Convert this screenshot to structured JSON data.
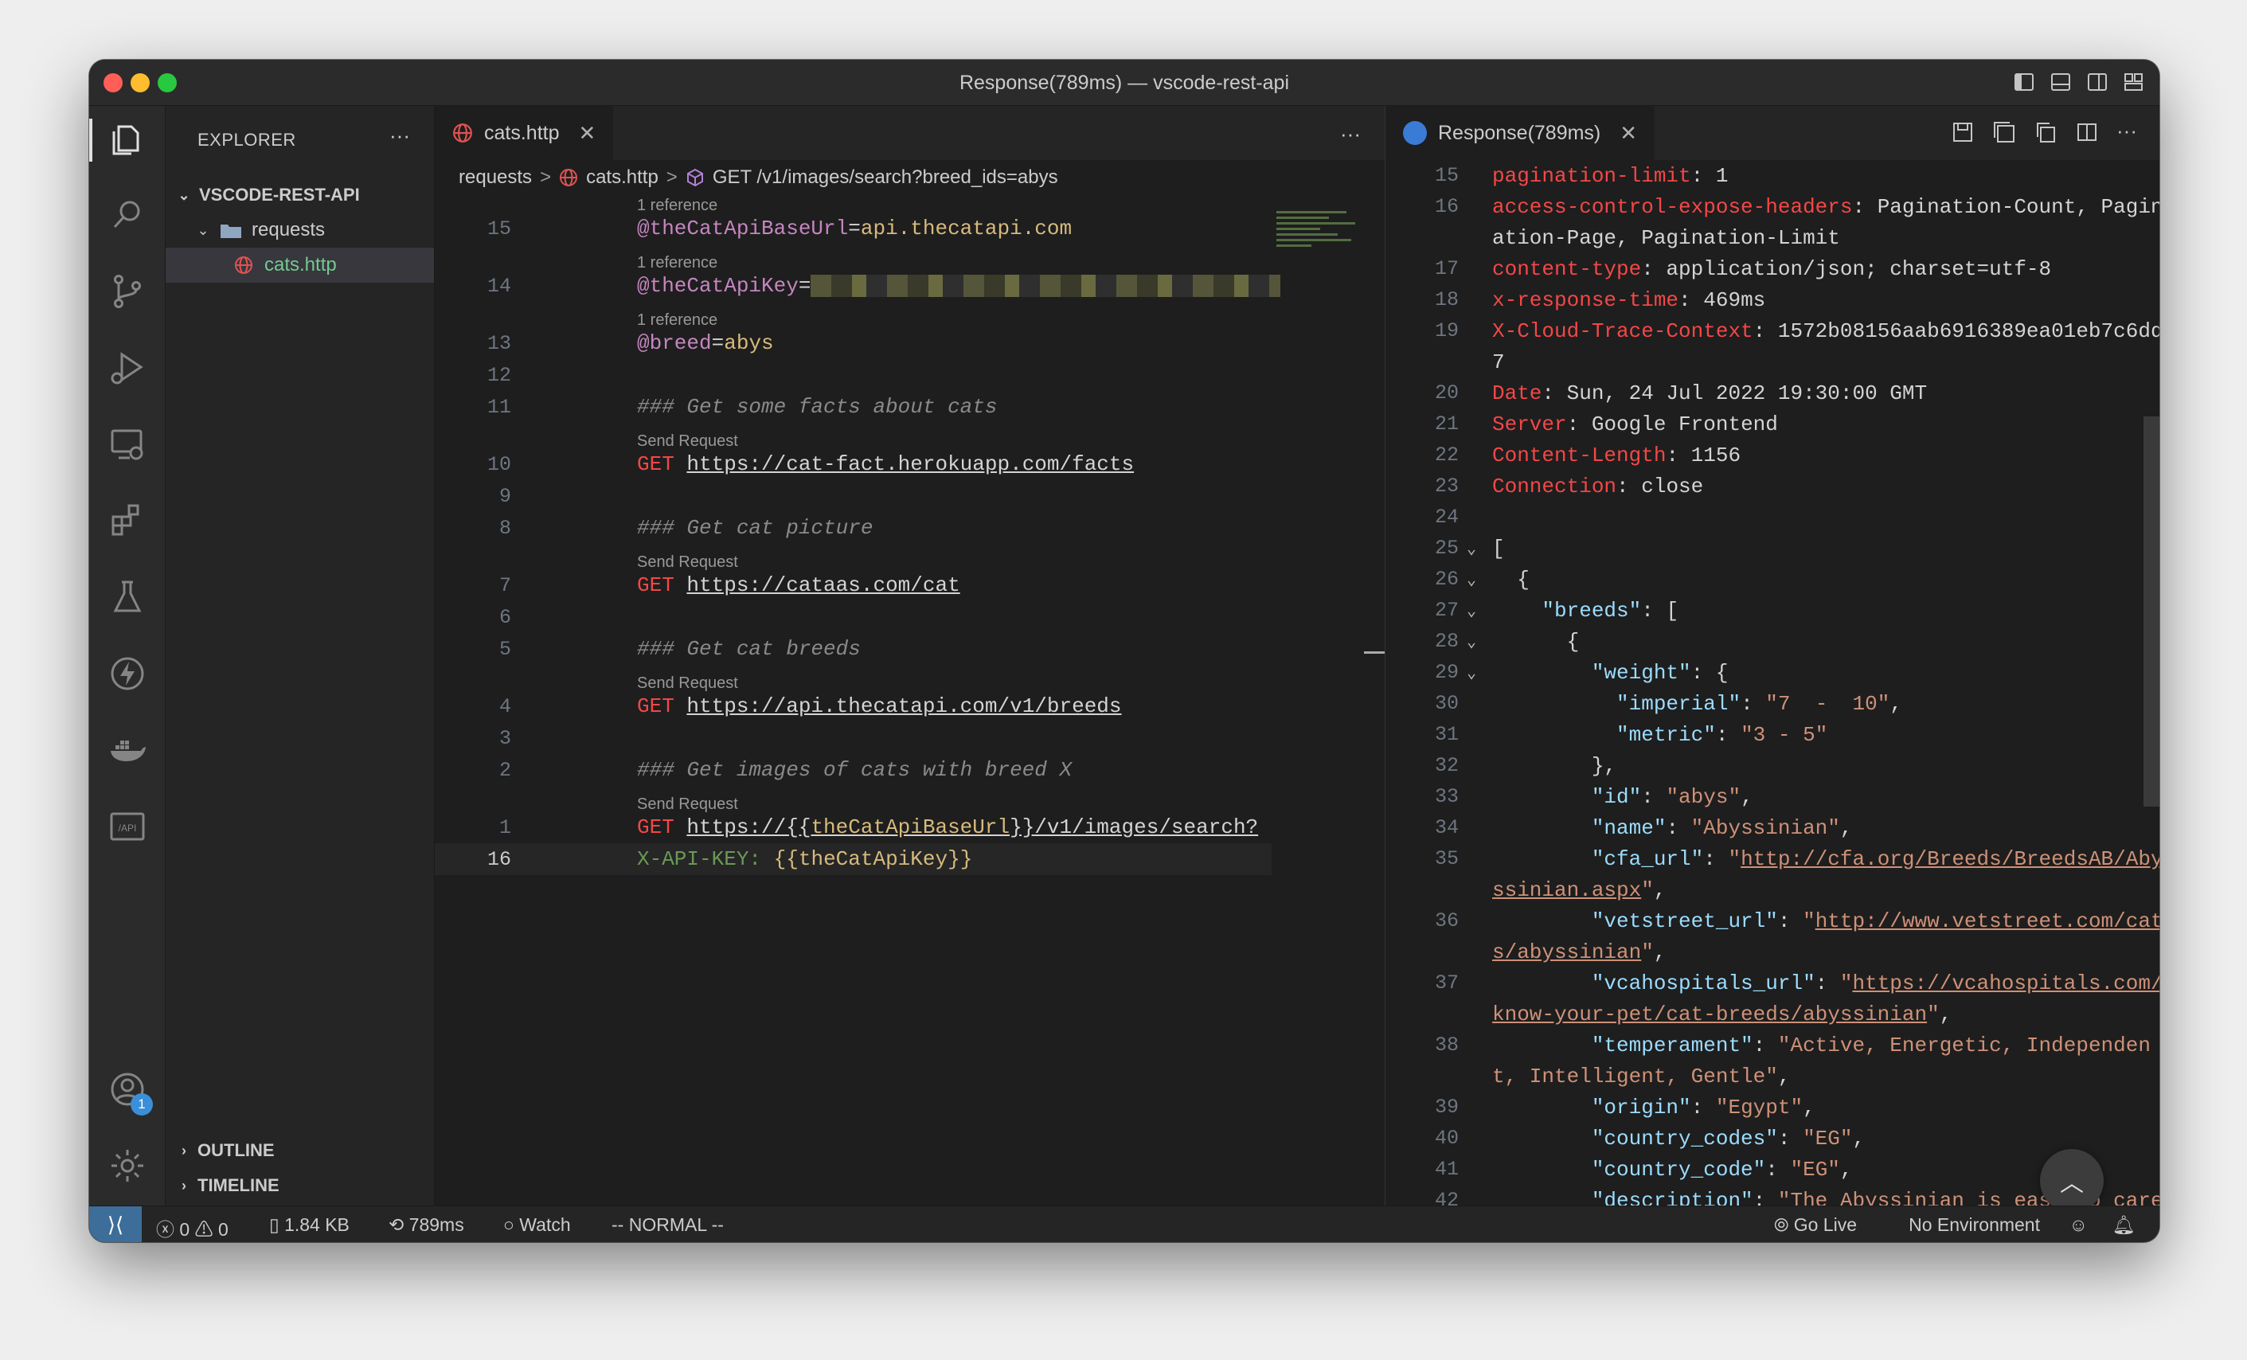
{
  "window": {
    "title": "Response(789ms) — vscode-rest-api"
  },
  "explorer": {
    "title": "EXPLORER",
    "more": "···",
    "project": "VSCODE-REST-API",
    "folder": "requests",
    "file": "cats.http",
    "outline": "OUTLINE",
    "timeline": "TIMELINE"
  },
  "activity": {
    "icons": [
      "files-icon",
      "search-icon",
      "source-control-icon",
      "run-debug-icon",
      "remote-explorer-icon",
      "extensions-icon",
      "testing-icon",
      "thunder-client-icon",
      "docker-icon",
      "api-icon",
      "accounts-icon",
      "settings-gear-icon"
    ],
    "accounts_badge": "1"
  },
  "left_editor": {
    "tab_label": "cats.http",
    "tab_close": "✕",
    "more": "···",
    "breadcrumb": {
      "folder": "requests",
      "file": "cats.http",
      "symbol": "GET /v1/images/search?breed_ids=abys",
      "sep": ">"
    },
    "lens_reference": "1 reference",
    "lens_send": "Send Request",
    "lines": {
      "l15": {
        "num": "15",
        "var": "@theCatApiBaseUrl",
        "eq": "=",
        "val": "api.thecatapi.com"
      },
      "l14": {
        "num": "14",
        "var": "@theCatApiKey",
        "eq": "="
      },
      "l13": {
        "num": "13",
        "var": "@breed",
        "eq": "=",
        "val": "abys"
      },
      "l12": {
        "num": "12"
      },
      "l11": {
        "num": "11",
        "comment": "### Get some facts about cats"
      },
      "l10": {
        "num": "10",
        "method": "GET",
        "url": "https://cat-fact.herokuapp.com/facts"
      },
      "l9": {
        "num": "9"
      },
      "l8": {
        "num": "8",
        "comment": "### Get cat picture"
      },
      "l7": {
        "num": "7",
        "method": "GET",
        "url": "https://cataas.com/cat"
      },
      "l6": {
        "num": "6"
      },
      "l5": {
        "num": "5",
        "comment": "### Get cat breeds"
      },
      "l4": {
        "num": "4",
        "method": "GET",
        "url": "https://api.thecatapi.com/v1/breeds"
      },
      "l3": {
        "num": "3"
      },
      "l2": {
        "num": "2",
        "comment": "### Get images of cats with breed X"
      },
      "l1": {
        "num": "1",
        "method": "GET",
        "url_a": "https://{{",
        "url_var": "theCatApiBaseUrl",
        "url_b": "}}/v1/images/search?"
      },
      "l16": {
        "num": "16",
        "header": "X-API-KEY:",
        "hval_a": "{{",
        "hval_var": "theCatApiKey",
        "hval_b": "}}"
      }
    }
  },
  "right_editor": {
    "tab_label": "Response(789ms)",
    "tab_close": "✕",
    "more": "···",
    "lines": [
      {
        "n": "15",
        "k": "pagination-limit",
        "v": " 1"
      },
      {
        "n": "16",
        "k": "access-control-expose-headers",
        "v": " Pagination-Count, Pagin"
      },
      {
        "n": "",
        "cont": "ation-Page, Pagination-Limit"
      },
      {
        "n": "17",
        "k": "content-type",
        "v": " application/json; charset=utf-8"
      },
      {
        "n": "18",
        "k": "x-response-time",
        "v": " 469ms"
      },
      {
        "n": "19",
        "k": "X-Cloud-Trace-Context",
        "v": " 1572b08156aab6916389ea01eb7c6dd"
      },
      {
        "n": "",
        "cont": "7"
      },
      {
        "n": "20",
        "k": "Date",
        "v": " Sun, 24 Jul 2022 19:30:00 GMT"
      },
      {
        "n": "21",
        "k": "Server",
        "v": " Google Frontend"
      },
      {
        "n": "22",
        "k": "Content-Length",
        "v": " 1156"
      },
      {
        "n": "23",
        "k": "Connection",
        "v": " close"
      },
      {
        "n": "24"
      },
      {
        "n": "25",
        "fold": true,
        "raw": "["
      },
      {
        "n": "26",
        "fold": true,
        "raw": "  {"
      },
      {
        "n": "27",
        "fold": true,
        "jk": "    \"breeds\"",
        "tail": ": ["
      },
      {
        "n": "28",
        "fold": true,
        "raw": "      {"
      },
      {
        "n": "29",
        "fold": true,
        "jk": "        \"weight\"",
        "tail": ": {"
      },
      {
        "n": "30",
        "jk": "          \"imperial\"",
        "tail": ": ",
        "js": "\"7  -  10\"",
        "end": ","
      },
      {
        "n": "31",
        "jk": "          \"metric\"",
        "tail": ": ",
        "js": "\"3 - 5\""
      },
      {
        "n": "32",
        "raw": "        },"
      },
      {
        "n": "33",
        "jk": "        \"id\"",
        "tail": ": ",
        "js": "\"abys\"",
        "end": ","
      },
      {
        "n": "34",
        "jk": "        \"name\"",
        "tail": ": ",
        "js": "\"Abyssinian\"",
        "end": ","
      },
      {
        "n": "35",
        "jk": "        \"cfa_url\"",
        "tail": ": ",
        "js": "\"",
        "jl": "http://cfa.org/Breeds/BreedsAB/Aby"
      },
      {
        "n": "",
        "jl": "ssinian.aspx",
        "js": "\"",
        "end": ","
      },
      {
        "n": "36",
        "jk": "        \"vetstreet_url\"",
        "tail": ": ",
        "js": "\"",
        "jl": "http://www.vetstreet.com/cat"
      },
      {
        "n": "",
        "jl": "s/abyssinian",
        "js": "\"",
        "end": ","
      },
      {
        "n": "37",
        "jk": "        \"vcahospitals_url\"",
        "tail": ": ",
        "js": "\"",
        "jl": "https://vcahospitals.com/"
      },
      {
        "n": "",
        "jl": "know-your-pet/cat-breeds/abyssinian",
        "js": "\"",
        "end": ","
      },
      {
        "n": "38",
        "jk": "        \"temperament\"",
        "tail": ": ",
        "js": "\"Active, Energetic, Independen"
      },
      {
        "n": "",
        "js": "t, Intelligent, Gentle\"",
        "end": ","
      },
      {
        "n": "39",
        "jk": "        \"origin\"",
        "tail": ": ",
        "js": "\"Egypt\"",
        "end": ","
      },
      {
        "n": "40",
        "jk": "        \"country_codes\"",
        "tail": ": ",
        "js": "\"EG\"",
        "end": ","
      },
      {
        "n": "41",
        "jk": "        \"country_code\"",
        "tail": ": ",
        "js": "\"EG\"",
        "end": ","
      },
      {
        "n": "42",
        "jk": "        \"description\"",
        "tail": ": ",
        "js": "\"The Abyssinian is easy to care"
      }
    ]
  },
  "statusbar": {
    "errors": "0",
    "warnings": "0",
    "size": "1.84 KB",
    "time": "789ms",
    "watch": "Watch",
    "mode": "-- NORMAL --",
    "golive": "Go Live",
    "env": "No Environment"
  }
}
